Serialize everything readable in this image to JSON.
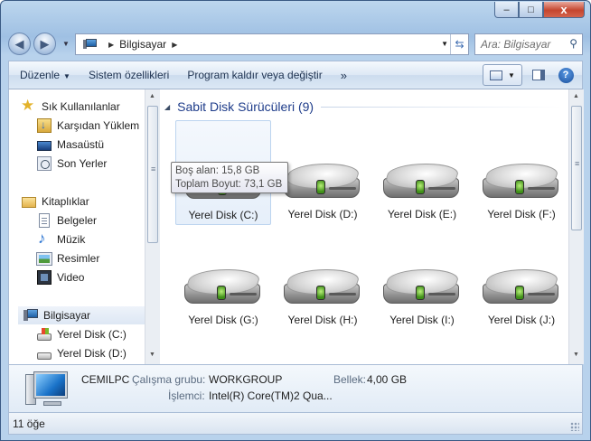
{
  "window": {
    "buttons": {
      "minimize": "–",
      "maximize": "□",
      "close": "x"
    }
  },
  "address": {
    "crumbs": [
      "Bilgisayar"
    ],
    "search_placeholder": "Ara: Bilgisayar"
  },
  "toolbar": {
    "organize": "Düzenle",
    "system_properties": "Sistem özellikleri",
    "uninstall": "Program kaldır veya değiştir",
    "more": "»"
  },
  "nav": {
    "favorites": "Sık Kullanılanlar",
    "fav_items": [
      "Karşıdan Yüklem",
      "Masaüstü",
      "Son Yerler"
    ],
    "libraries": "Kitaplıklar",
    "lib_items": [
      "Belgeler",
      "Müzik",
      "Resimler",
      "Video"
    ],
    "computer": "Bilgisayar",
    "computer_items": [
      "Yerel Disk (C:)",
      "Yerel Disk (D:)"
    ]
  },
  "main": {
    "group_title": "Sabit Disk Sürücüleri (9)",
    "drives": [
      "Yerel Disk (C:)",
      "Yerel Disk (D:)",
      "Yerel Disk (E:)",
      "Yerel Disk (F:)",
      "Yerel Disk (G:)",
      "Yerel Disk (H:)",
      "Yerel Disk (I:)",
      "Yerel Disk (J:)"
    ],
    "tooltip": {
      "free": "Boş alan: 15,8 GB",
      "total": "Toplam Boyut: 73,1 GB"
    }
  },
  "details": {
    "name": "CEMILPC",
    "workgroup_label": "Çalışma grubu:",
    "workgroup_value": "WORKGROUP",
    "memory_label": "Bellek:",
    "memory_value": "4,00 GB",
    "cpu_label": "İşlemci:",
    "cpu_value": "Intel(R) Core(TM)2 Qua..."
  },
  "status": {
    "count": "11 öğe"
  }
}
